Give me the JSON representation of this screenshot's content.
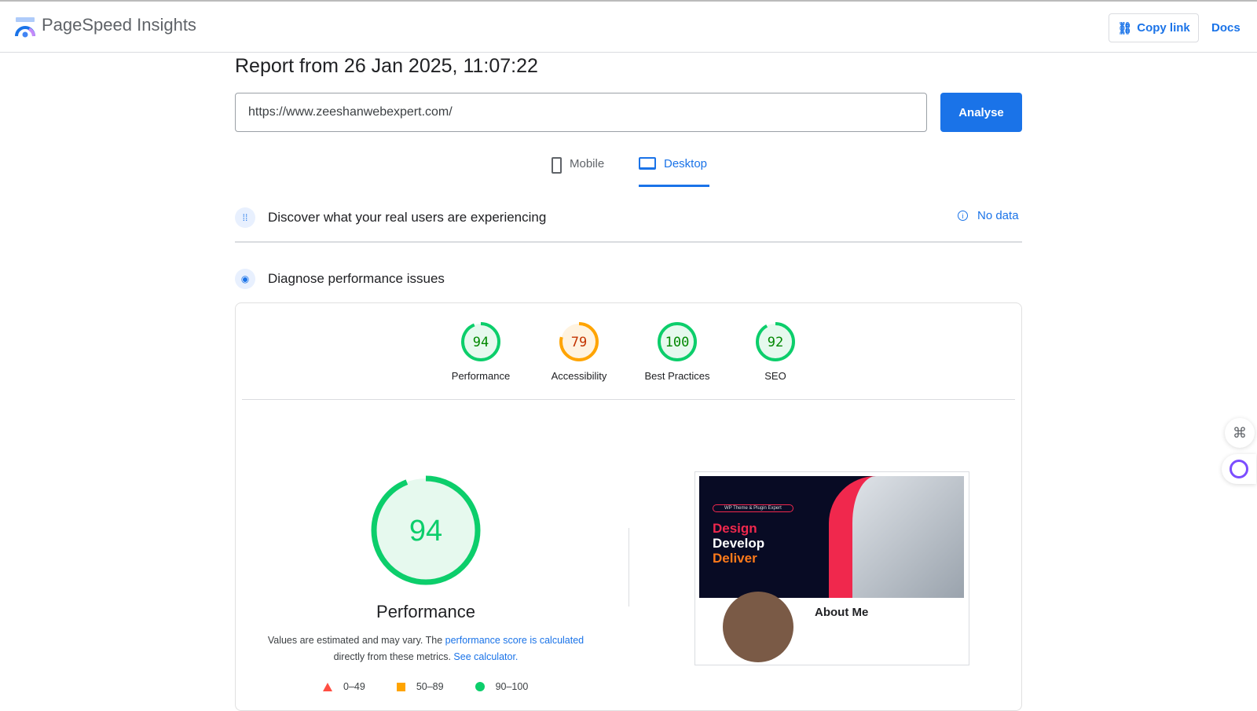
{
  "header": {
    "brand": "PageSpeed Insights",
    "copy_link": "Copy link",
    "docs": "Docs"
  },
  "report": {
    "title": "Report from 26 Jan 2025, 11:07:22",
    "url": "https://www.zeeshanwebexpert.com/",
    "analyse": "Analyse"
  },
  "tabs": [
    {
      "label": "Mobile"
    },
    {
      "label": "Desktop"
    }
  ],
  "field": {
    "title": "Discover what your real users are experiencing",
    "status": "No data"
  },
  "diagnose": {
    "title": "Diagnose performance issues"
  },
  "scores": [
    {
      "label": "Performance",
      "value": 94,
      "color": "#0cce6b"
    },
    {
      "label": "Accessibility",
      "value": 79,
      "color": "#ffa400"
    },
    {
      "label": "Best Practices",
      "value": 100,
      "color": "#0cce6b"
    },
    {
      "label": "SEO",
      "value": 92,
      "color": "#0cce6b"
    }
  ],
  "main": {
    "score": 94,
    "label": "Performance",
    "note_pre": "Values are estimated and may vary. The ",
    "note_link": "performance score is calculated",
    "note_mid": " directly from these metrics. ",
    "calc_link": "See calculator."
  },
  "legend": [
    {
      "range": "0–49",
      "color": "#ff4e42"
    },
    {
      "range": "50–89",
      "color": "#ffa400"
    },
    {
      "range": "90–100",
      "color": "#0cce6b"
    }
  ],
  "screenshot": {
    "l1": "Design",
    "l2": "Develop",
    "l3": "Deliver",
    "about": "About Me",
    "tag": "WP Theme & Plugin Expert"
  }
}
